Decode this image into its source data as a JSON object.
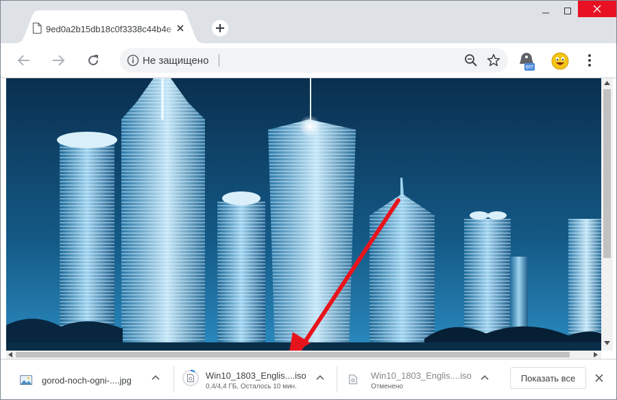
{
  "window": {
    "minimize": "minimize",
    "maximize": "maximize",
    "close": "close"
  },
  "tab": {
    "title": "9ed0a2b15db18c0f3338c44b4e"
  },
  "toolbar": {
    "security_text": "Не защищено",
    "extension_badge": "err"
  },
  "colors": {
    "chrome_bg": "#dee1e6",
    "close_red": "#e81123",
    "arrow_red": "#e8141c",
    "sky": "#0a3556",
    "badge_blue": "#4a89dc"
  },
  "downloads": [
    {
      "name": "gorod-noch-ogni-....jpg",
      "status": "",
      "icon": "image-file-icon"
    },
    {
      "name": "Win10_1803_Englis....iso",
      "status": "0,4/4,4 ГБ, Осталось 10 мин.",
      "icon": "disc-file-icon",
      "progress": 0.09
    },
    {
      "name": "Win10_1803_Englis....iso",
      "status": "Отменено",
      "icon": "file-icon"
    }
  ],
  "shelf": {
    "show_all": "Показать все"
  }
}
